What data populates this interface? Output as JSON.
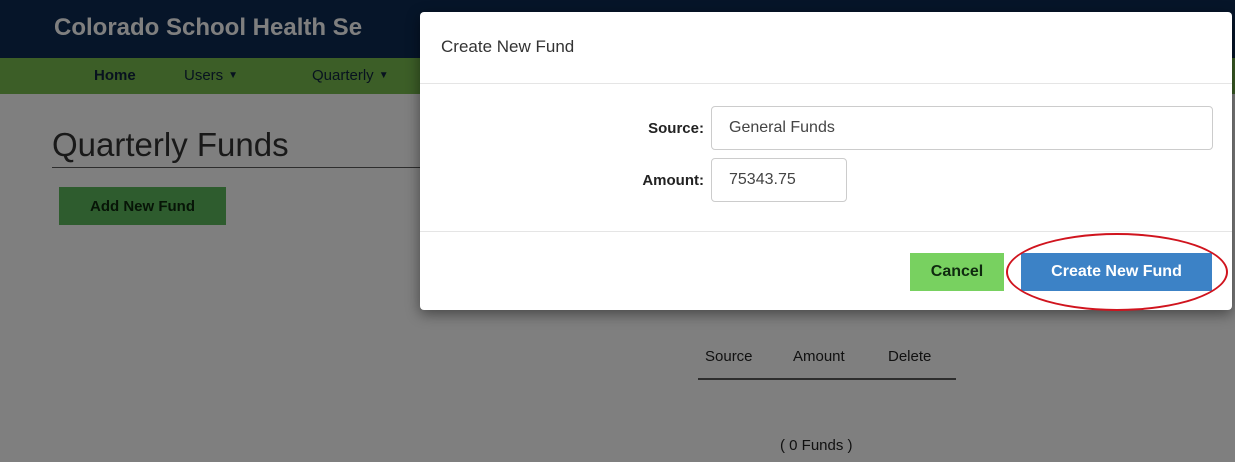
{
  "header": {
    "brand_title": "Colorado School Health Se",
    "nav": {
      "home": "Home",
      "users": "Users",
      "quarterly": "Quarterly"
    }
  },
  "page": {
    "title": "Quarterly Funds",
    "add_button": "Add New Fund",
    "table": {
      "columns": [
        "Source",
        "Amount",
        "Delete"
      ]
    },
    "count_text": "( 0 Funds )"
  },
  "modal": {
    "title": "Create New Fund",
    "fields": {
      "source_label": "Source:",
      "source_value": "General Funds",
      "amount_label": "Amount:",
      "amount_value": "75343.75"
    },
    "cancel_label": "Cancel",
    "create_label": "Create New Fund"
  },
  "icons": {
    "caret": "caret-down-icon"
  },
  "colors": {
    "brand_bar": "#0d2b52",
    "nav_bar": "#78bc4f",
    "primary": "#3c82c6",
    "success": "#5cb85c",
    "highlight": "#d0141e"
  }
}
